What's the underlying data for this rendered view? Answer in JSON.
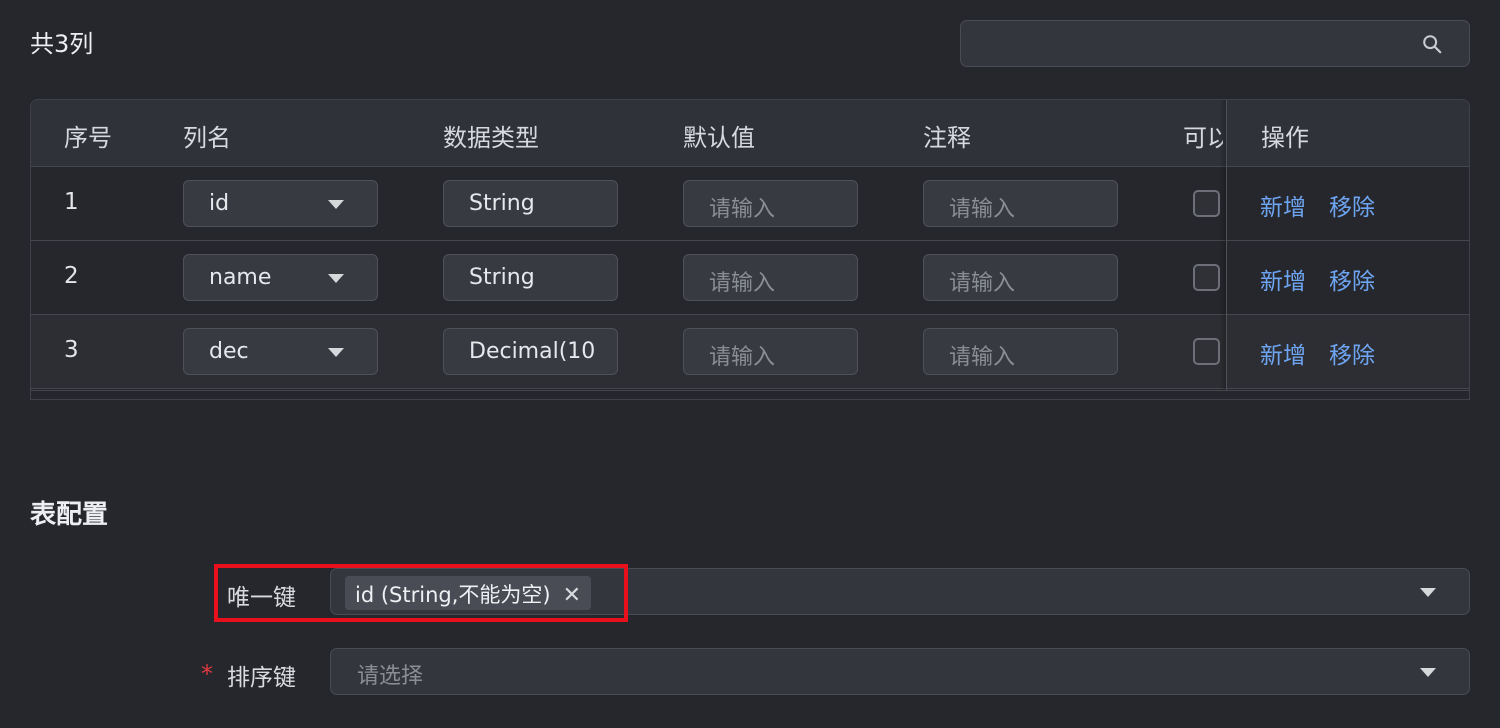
{
  "header": {
    "count_title": "共3列",
    "search_placeholder": ""
  },
  "table": {
    "columns": [
      "序号",
      "列名",
      "数据类型",
      "默认值",
      "注释",
      "可以",
      "操作"
    ],
    "rows": [
      {
        "index": "1",
        "name": "id",
        "type": "String",
        "default_placeholder": "请输入",
        "comment_placeholder": "请输入",
        "nullable": false,
        "add": "新增",
        "remove": "移除"
      },
      {
        "index": "2",
        "name": "name",
        "type": "String",
        "default_placeholder": "请输入",
        "comment_placeholder": "请输入",
        "nullable": false,
        "add": "新增",
        "remove": "移除"
      },
      {
        "index": "3",
        "name": "dec",
        "type": "Decimal(10",
        "default_placeholder": "请输入",
        "comment_placeholder": "请输入",
        "nullable": false,
        "add": "新增",
        "remove": "移除"
      }
    ]
  },
  "config": {
    "section_title": "表配置",
    "unique_key": {
      "label": "唯一键",
      "tag": "id (String,不能为空)",
      "tag_close": "✕"
    },
    "sort_key": {
      "required_mark": "*",
      "label": "排序键",
      "placeholder": "请选择"
    }
  },
  "colors": {
    "background": "#26272c",
    "link": "#6ea5f2",
    "highlight": "#e8101a",
    "required": "#e0393e"
  }
}
